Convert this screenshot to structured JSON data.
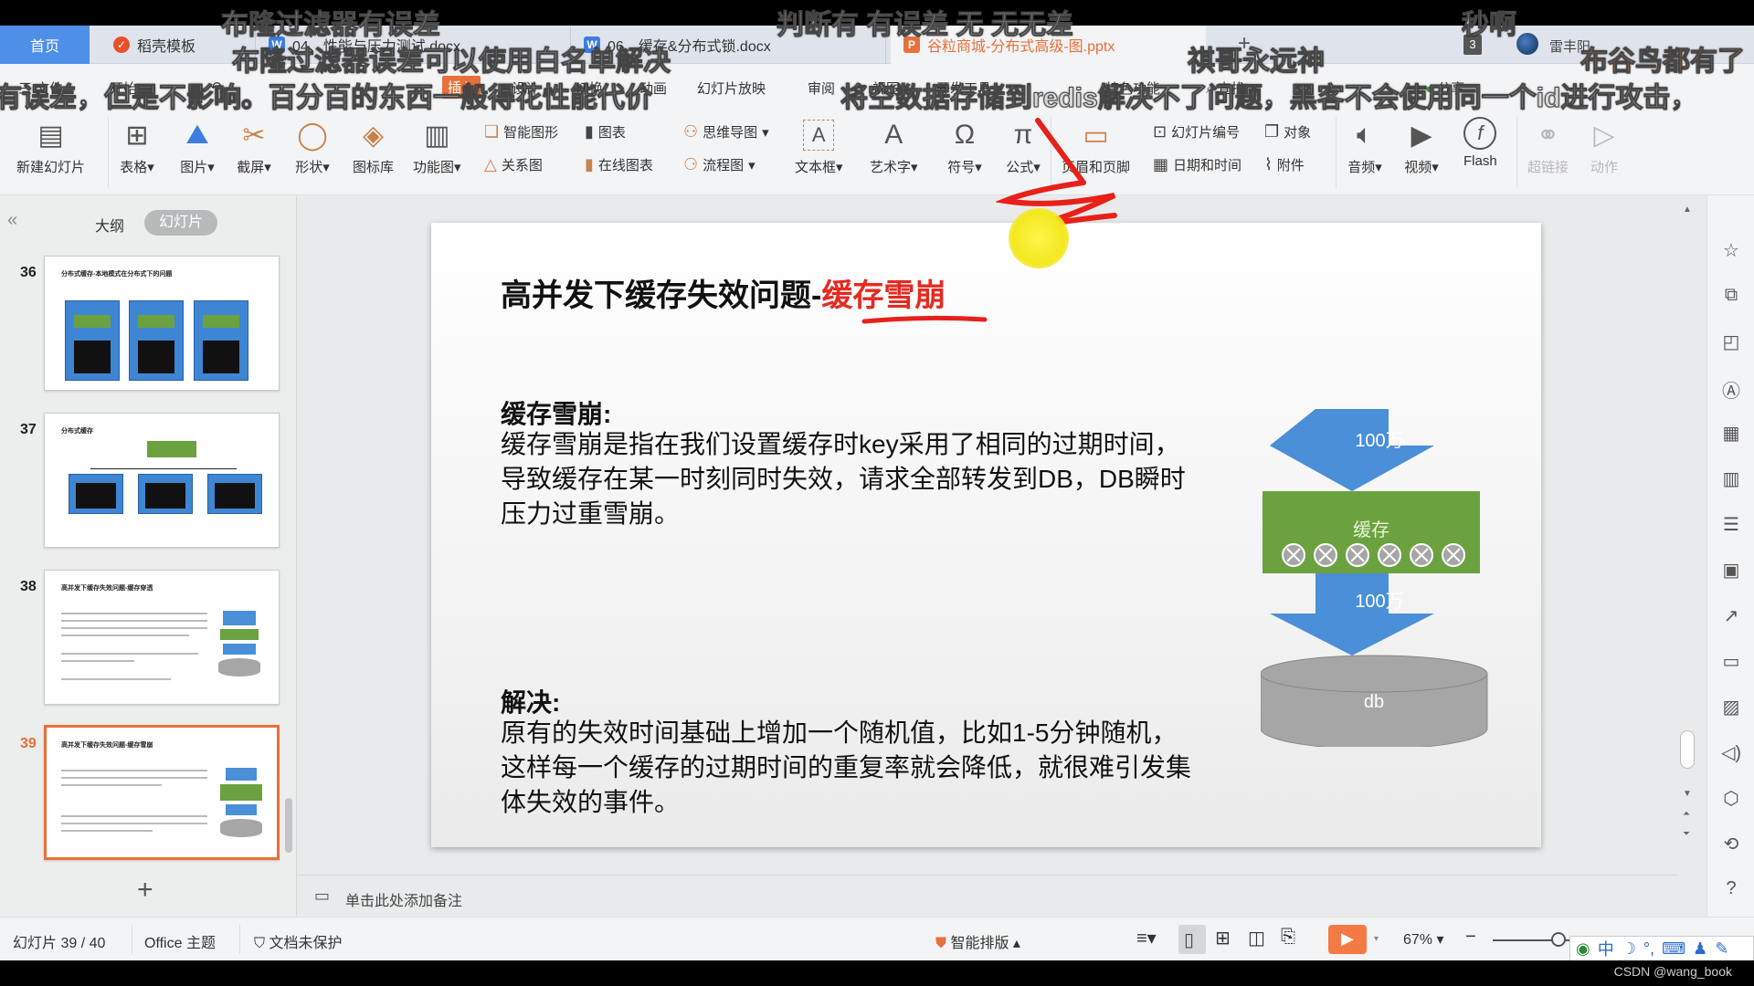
{
  "tabs": {
    "home": "首页",
    "items": [
      {
        "label": "稻壳模板",
        "icon": "docer-icon"
      },
      {
        "label": "04、性能与压力测试.docx",
        "icon": "word-icon"
      },
      {
        "label": "06、缓存&分布式锁.docx",
        "icon": "word-icon"
      },
      {
        "label": "谷粒商城-分布式高级-图.pptx",
        "icon": "ppt-icon"
      }
    ],
    "add": "+",
    "badge_count": "3",
    "user": "雷丰阳"
  },
  "menu": {
    "items": [
      "三 文件",
      "开始",
      "插入",
      "设计",
      "切换",
      "动画",
      "幻灯片放映",
      "审阅",
      "视图",
      "开发工具",
      "特色功能",
      "查找"
    ],
    "active": "插入",
    "share": "分享"
  },
  "ribbon": {
    "new_slide": "新建幻灯片",
    "table": "表格",
    "picture": "图片",
    "screenshot": "截屏",
    "shape": "形状",
    "icon_lib": "图标库",
    "func_chart": "功能图",
    "smart_art": "智能图形",
    "chart": "图表",
    "relation": "关系图",
    "online_chart": "在线图表",
    "mind_map": "思维导图",
    "flowchart": "流程图",
    "textbox": "文本框",
    "wordart": "艺术字",
    "symbol": "符号",
    "formula": "公式",
    "header_footer": "页眉和页脚",
    "slide_number": "幻灯片编号",
    "object": "对象",
    "datetime": "日期和时间",
    "attachment": "附件",
    "audio": "音频",
    "video": "视频",
    "flash": "Flash",
    "hyperlink": "超链接",
    "action": "动作"
  },
  "left_panel": {
    "outline_tab": "大纲",
    "slides_tab": "幻灯片",
    "collapse": "«",
    "add": "+",
    "thumbnails": [
      {
        "num": "36",
        "title": "分布式缓存-本地模式在分布式下的问题"
      },
      {
        "num": "37",
        "title": "分布式缓存"
      },
      {
        "num": "38",
        "title": "高并发下缓存失效问题-缓存穿透"
      },
      {
        "num": "39",
        "title": "高并发下缓存失效问题-缓存雪崩",
        "selected": true
      }
    ]
  },
  "slide": {
    "title_black": "高并发下缓存失效问题-",
    "title_red": "缓存雪崩",
    "h1": "缓存雪崩:",
    "p1": "缓存雪崩是指在我们设置缓存时key采用了相同的过期时间，导致缓存在某一时刻同时失效，请求全部转发到DB，DB瞬时压力过重雪崩。",
    "h2": "解决:",
    "p2": "原有的失效时间基础上增加一个随机值，比如1-5分钟随机，这样每一个缓存的过期时间的重复率就会降低，就很难引发集体失效的事件。",
    "diagram": {
      "arrow1": "100万",
      "cache": "缓存",
      "arrow2": "100万",
      "db": "db",
      "x_count": 6
    }
  },
  "notes": {
    "placeholder": "单击此处添加备注"
  },
  "status": {
    "slide_pos": "幻灯片 39 / 40",
    "theme": "Office 主题",
    "protect": "文档未保护",
    "smart_layout": "智能排版",
    "zoom": "67%",
    "zoom_level": 0.67,
    "ime": "中",
    "watermark": "CSDN @wang_book"
  },
  "overlay_subtitles": [
    "布隆过滤器有误差",
    "判断有  有误差  无  无无差",
    "秒啊",
    "布隆过滤器误差可以使用白名单解决",
    "祺哥永远神",
    "布谷鸟都有了",
    "有误差，但是不影响。百分百的东西一般得花性能代价",
    "将空数据存储到redis解决不了问题，黑客不会使用同一个id进行攻击，"
  ],
  "colors": {
    "accent": "#e8703a",
    "home_tab": "#4e8fe8",
    "title_red": "#e52a22",
    "arrow_blue": "#4a8fd8",
    "cache_green": "#6ba23f",
    "db_gray": "#a6a6a6"
  }
}
